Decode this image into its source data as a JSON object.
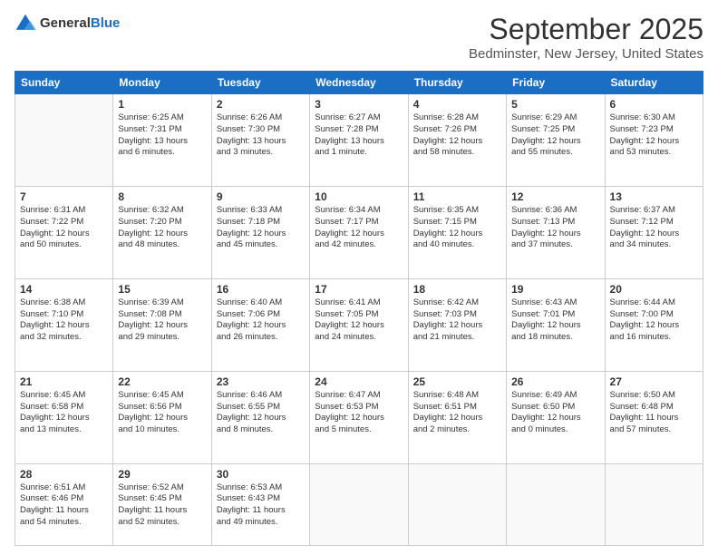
{
  "logo": {
    "general": "General",
    "blue": "Blue"
  },
  "header": {
    "month": "September 2025",
    "location": "Bedminster, New Jersey, United States"
  },
  "days_of_week": [
    "Sunday",
    "Monday",
    "Tuesday",
    "Wednesday",
    "Thursday",
    "Friday",
    "Saturday"
  ],
  "weeks": [
    [
      {
        "day": "",
        "info": ""
      },
      {
        "day": "1",
        "info": "Sunrise: 6:25 AM\nSunset: 7:31 PM\nDaylight: 13 hours\nand 6 minutes."
      },
      {
        "day": "2",
        "info": "Sunrise: 6:26 AM\nSunset: 7:30 PM\nDaylight: 13 hours\nand 3 minutes."
      },
      {
        "day": "3",
        "info": "Sunrise: 6:27 AM\nSunset: 7:28 PM\nDaylight: 13 hours\nand 1 minute."
      },
      {
        "day": "4",
        "info": "Sunrise: 6:28 AM\nSunset: 7:26 PM\nDaylight: 12 hours\nand 58 minutes."
      },
      {
        "day": "5",
        "info": "Sunrise: 6:29 AM\nSunset: 7:25 PM\nDaylight: 12 hours\nand 55 minutes."
      },
      {
        "day": "6",
        "info": "Sunrise: 6:30 AM\nSunset: 7:23 PM\nDaylight: 12 hours\nand 53 minutes."
      }
    ],
    [
      {
        "day": "7",
        "info": "Sunrise: 6:31 AM\nSunset: 7:22 PM\nDaylight: 12 hours\nand 50 minutes."
      },
      {
        "day": "8",
        "info": "Sunrise: 6:32 AM\nSunset: 7:20 PM\nDaylight: 12 hours\nand 48 minutes."
      },
      {
        "day": "9",
        "info": "Sunrise: 6:33 AM\nSunset: 7:18 PM\nDaylight: 12 hours\nand 45 minutes."
      },
      {
        "day": "10",
        "info": "Sunrise: 6:34 AM\nSunset: 7:17 PM\nDaylight: 12 hours\nand 42 minutes."
      },
      {
        "day": "11",
        "info": "Sunrise: 6:35 AM\nSunset: 7:15 PM\nDaylight: 12 hours\nand 40 minutes."
      },
      {
        "day": "12",
        "info": "Sunrise: 6:36 AM\nSunset: 7:13 PM\nDaylight: 12 hours\nand 37 minutes."
      },
      {
        "day": "13",
        "info": "Sunrise: 6:37 AM\nSunset: 7:12 PM\nDaylight: 12 hours\nand 34 minutes."
      }
    ],
    [
      {
        "day": "14",
        "info": "Sunrise: 6:38 AM\nSunset: 7:10 PM\nDaylight: 12 hours\nand 32 minutes."
      },
      {
        "day": "15",
        "info": "Sunrise: 6:39 AM\nSunset: 7:08 PM\nDaylight: 12 hours\nand 29 minutes."
      },
      {
        "day": "16",
        "info": "Sunrise: 6:40 AM\nSunset: 7:06 PM\nDaylight: 12 hours\nand 26 minutes."
      },
      {
        "day": "17",
        "info": "Sunrise: 6:41 AM\nSunset: 7:05 PM\nDaylight: 12 hours\nand 24 minutes."
      },
      {
        "day": "18",
        "info": "Sunrise: 6:42 AM\nSunset: 7:03 PM\nDaylight: 12 hours\nand 21 minutes."
      },
      {
        "day": "19",
        "info": "Sunrise: 6:43 AM\nSunset: 7:01 PM\nDaylight: 12 hours\nand 18 minutes."
      },
      {
        "day": "20",
        "info": "Sunrise: 6:44 AM\nSunset: 7:00 PM\nDaylight: 12 hours\nand 16 minutes."
      }
    ],
    [
      {
        "day": "21",
        "info": "Sunrise: 6:45 AM\nSunset: 6:58 PM\nDaylight: 12 hours\nand 13 minutes."
      },
      {
        "day": "22",
        "info": "Sunrise: 6:45 AM\nSunset: 6:56 PM\nDaylight: 12 hours\nand 10 minutes."
      },
      {
        "day": "23",
        "info": "Sunrise: 6:46 AM\nSunset: 6:55 PM\nDaylight: 12 hours\nand 8 minutes."
      },
      {
        "day": "24",
        "info": "Sunrise: 6:47 AM\nSunset: 6:53 PM\nDaylight: 12 hours\nand 5 minutes."
      },
      {
        "day": "25",
        "info": "Sunrise: 6:48 AM\nSunset: 6:51 PM\nDaylight: 12 hours\nand 2 minutes."
      },
      {
        "day": "26",
        "info": "Sunrise: 6:49 AM\nSunset: 6:50 PM\nDaylight: 12 hours\nand 0 minutes."
      },
      {
        "day": "27",
        "info": "Sunrise: 6:50 AM\nSunset: 6:48 PM\nDaylight: 11 hours\nand 57 minutes."
      }
    ],
    [
      {
        "day": "28",
        "info": "Sunrise: 6:51 AM\nSunset: 6:46 PM\nDaylight: 11 hours\nand 54 minutes."
      },
      {
        "day": "29",
        "info": "Sunrise: 6:52 AM\nSunset: 6:45 PM\nDaylight: 11 hours\nand 52 minutes."
      },
      {
        "day": "30",
        "info": "Sunrise: 6:53 AM\nSunset: 6:43 PM\nDaylight: 11 hours\nand 49 minutes."
      },
      {
        "day": "",
        "info": ""
      },
      {
        "day": "",
        "info": ""
      },
      {
        "day": "",
        "info": ""
      },
      {
        "day": "",
        "info": ""
      }
    ]
  ]
}
